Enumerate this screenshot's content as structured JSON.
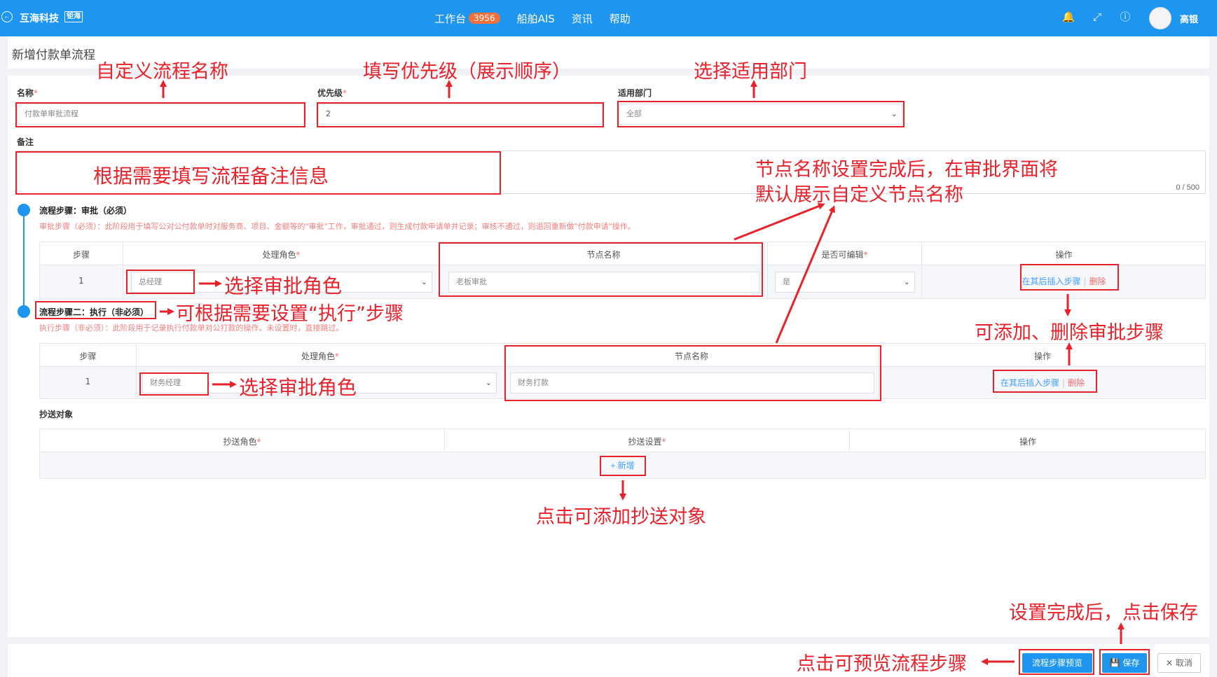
{
  "topbar": {
    "brand": "互海科技",
    "brand_badge": "钜海",
    "nav": [
      {
        "label": "工作台",
        "badge": "3956"
      },
      {
        "label": "船舶AIS"
      },
      {
        "label": "资讯"
      },
      {
        "label": "帮助"
      }
    ],
    "user": "高银"
  },
  "page_title": "新增付款单流程",
  "form": {
    "name_label": "名称",
    "name_value": "付款单审批流程",
    "priority_label": "优先级",
    "priority_value": "2",
    "dept_label": "适用部门",
    "dept_value": "全部",
    "remark_label": "备注",
    "remark_counter": "0 / 500",
    "required_mark": "*"
  },
  "step1": {
    "title": "流程步骤：审批（必须）",
    "desc": "审批步骤（必须）：此阶段用于填写公对公付款单时对服务商、项目、金额等的\"审批\"工作，审批通过，则生成付款申请单并记录；审核不通过，则退回重新做\"付款申请\"操作。",
    "headers": [
      "步骤",
      "处理角色",
      "节点名称",
      "是否可编辑",
      "操作"
    ],
    "row": {
      "step": "1",
      "role": "总经理",
      "node": "老板审批",
      "editable": "是",
      "insert": "在其后插入步骤",
      "delete": "删除"
    }
  },
  "step2": {
    "title": "流程步骤二：执行（非必须）",
    "desc": "执行步骤（非必须）：此阶段用于记录执行付款单对公打款的操作。未设置时，直接跳过。",
    "headers": [
      "步骤",
      "处理角色",
      "节点名称",
      "操作"
    ],
    "row": {
      "step": "1",
      "role": "财务经理",
      "node": "财务打款",
      "insert": "在其后插入步骤",
      "delete": "删除"
    }
  },
  "cc": {
    "title": "抄送对象",
    "headers": [
      "抄送角色",
      "抄送设置",
      "操作"
    ],
    "add": "+ 新增"
  },
  "buttons": {
    "preview": "流程步骤预览",
    "save": "保存",
    "cancel": "取消"
  },
  "annotations": {
    "custom_name": "自定义流程名称",
    "priority": "填写优先级（展示顺序）",
    "dept": "选择适用部门",
    "remark": "根据需要填写流程备注信息",
    "node_line1": "节点名称设置完成后，在审批界面将",
    "node_line2": "默认展示自定义节点名称",
    "role1": "选择审批角色",
    "exec_step": "可根据需要设置“执行”步骤",
    "add_delete": "可添加、删除审批步骤",
    "role2": "选择审批角色",
    "add_cc": "点击可添加抄送对象",
    "save_hint": "设置完成后，点击保存",
    "preview_hint": "点击可预览流程步骤"
  },
  "colors": {
    "topbar": "#1e96f0",
    "annotation": "#e8222b",
    "primary": "#1e96f0"
  }
}
